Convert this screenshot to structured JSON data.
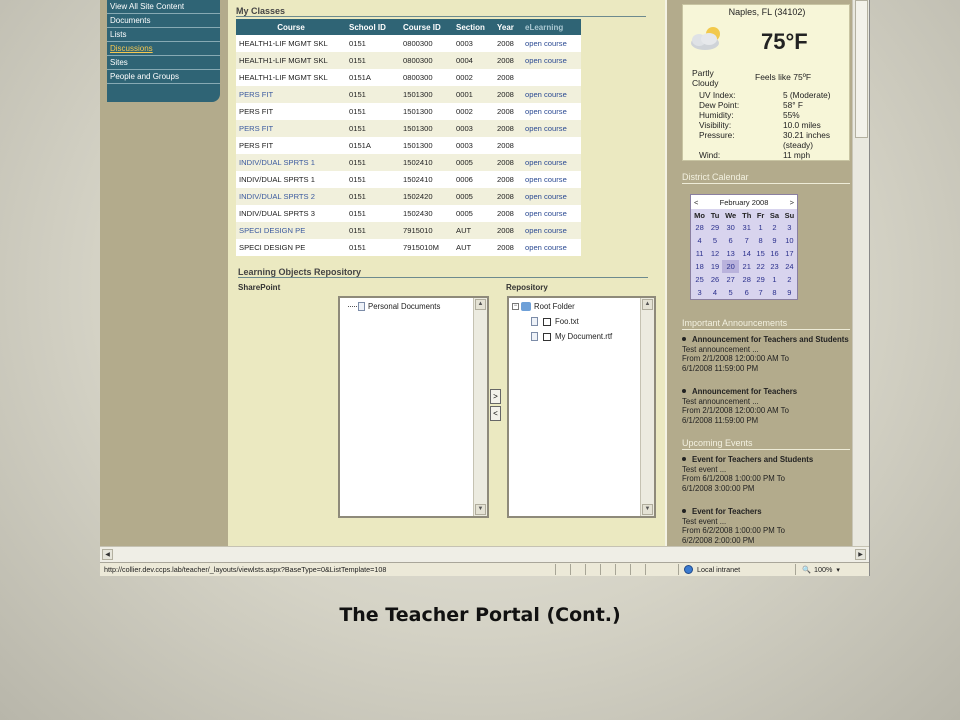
{
  "leftnav": {
    "items": [
      {
        "label": "View All Site Content",
        "active": false
      },
      {
        "label": "Documents",
        "active": false
      },
      {
        "label": "Lists",
        "active": false
      },
      {
        "label": "Discussions",
        "active": true
      },
      {
        "label": "Sites",
        "active": false
      },
      {
        "label": "People and Groups",
        "active": false
      }
    ]
  },
  "my_classes": {
    "title": "My Classes",
    "columns": [
      "Course",
      "School ID",
      "Course ID",
      "Section",
      "Year",
      "eLearning"
    ],
    "rows": [
      {
        "course": "HEALTH1-LIF MGMT SKL",
        "school": "0151",
        "course_id": "0800300",
        "section": "0003",
        "year": "2008",
        "elearning": "open course",
        "link": false
      },
      {
        "course": "HEALTH1-LIF MGMT SKL",
        "school": "0151",
        "course_id": "0800300",
        "section": "0004",
        "year": "2008",
        "elearning": "open course",
        "link": false
      },
      {
        "course": "HEALTH1-LIF MGMT SKL",
        "school": "0151A",
        "course_id": "0800300",
        "section": "0002",
        "year": "2008",
        "elearning": "",
        "link": false
      },
      {
        "course": "PERS FIT",
        "school": "0151",
        "course_id": "1501300",
        "section": "0001",
        "year": "2008",
        "elearning": "open course",
        "link": true
      },
      {
        "course": "PERS FIT",
        "school": "0151",
        "course_id": "1501300",
        "section": "0002",
        "year": "2008",
        "elearning": "open course",
        "link": false
      },
      {
        "course": "PERS FIT",
        "school": "0151",
        "course_id": "1501300",
        "section": "0003",
        "year": "2008",
        "elearning": "open course",
        "link": true
      },
      {
        "course": "PERS FIT",
        "school": "0151A",
        "course_id": "1501300",
        "section": "0003",
        "year": "2008",
        "elearning": "",
        "link": false
      },
      {
        "course": "INDIV/DUAL SPRTS 1",
        "school": "0151",
        "course_id": "1502410",
        "section": "0005",
        "year": "2008",
        "elearning": "open course",
        "link": true
      },
      {
        "course": "INDIV/DUAL SPRTS 1",
        "school": "0151",
        "course_id": "1502410",
        "section": "0006",
        "year": "2008",
        "elearning": "open course",
        "link": false
      },
      {
        "course": "INDIV/DUAL SPRTS 2",
        "school": "0151",
        "course_id": "1502420",
        "section": "0005",
        "year": "2008",
        "elearning": "open course",
        "link": true
      },
      {
        "course": "INDIV/DUAL SPRTS 3",
        "school": "0151",
        "course_id": "1502430",
        "section": "0005",
        "year": "2008",
        "elearning": "open course",
        "link": false
      },
      {
        "course": "SPECI DESIGN PE",
        "school": "0151",
        "course_id": "7915010",
        "section": "AUT",
        "year": "2008",
        "elearning": "open course",
        "link": true
      },
      {
        "course": "SPECI DESIGN PE",
        "school": "0151",
        "course_id": "7915010M",
        "section": "AUT",
        "year": "2008",
        "elearning": "open course",
        "link": false
      }
    ]
  },
  "repository": {
    "title": "Learning Objects Repository",
    "sharepoint_label": "SharePoint",
    "repository_label": "Repository",
    "sharepoint_items": [
      "Personal Documents"
    ],
    "root_folder": "Root Folder",
    "repository_items": [
      "Foo.txt",
      "My Document.rtf"
    ],
    "move_right": ">",
    "move_left": "<"
  },
  "weather": {
    "location": "Naples, FL (34102)",
    "temperature": "75°F",
    "condition": "Partly Cloudy",
    "feels_like": "Feels like 75ºF",
    "icon": "partly-cloudy-icon",
    "rows": [
      {
        "key": "UV Index:",
        "value": "5 (Moderate)"
      },
      {
        "key": "Dew Point:",
        "value": "58° F"
      },
      {
        "key": "Humidity:",
        "value": "55%"
      },
      {
        "key": "Visibility:",
        "value": "10.0 miles"
      },
      {
        "key": "Pressure:",
        "value": "30.21 inches"
      },
      {
        "key": "",
        "value": "(steady)"
      },
      {
        "key": "Wind:",
        "value": "11 mph"
      }
    ]
  },
  "district_calendar": {
    "title": "District Calendar",
    "month": "February 2008",
    "prev": "<",
    "next": ">",
    "weekdays": [
      "Mo",
      "Tu",
      "We",
      "Th",
      "Fr",
      "Sa",
      "Su"
    ],
    "weeks": [
      [
        "28",
        "29",
        "30",
        "31",
        "1",
        "2",
        "3"
      ],
      [
        "4",
        "5",
        "6",
        "7",
        "8",
        "9",
        "10"
      ],
      [
        "11",
        "12",
        "13",
        "14",
        "15",
        "16",
        "17"
      ],
      [
        "18",
        "19",
        "20",
        "21",
        "22",
        "23",
        "24"
      ],
      [
        "25",
        "26",
        "27",
        "28",
        "29",
        "1",
        "2"
      ],
      [
        "3",
        "4",
        "5",
        "6",
        "7",
        "8",
        "9"
      ]
    ],
    "today": "20"
  },
  "announcements": {
    "title": "Important Announcements",
    "items": [
      {
        "title": "Announcement for Teachers and Students",
        "body": "Test announcement ...",
        "from": "From 2/1/2008 12:00:00 AM To",
        "to": "6/1/2008 11:59:00 PM"
      },
      {
        "title": "Announcement for Teachers",
        "body": "Test announcement ...",
        "from": "From 2/1/2008 12:00:00 AM To",
        "to": "6/1/2008 11:59:00 PM"
      }
    ]
  },
  "events": {
    "title": "Upcoming Events",
    "items": [
      {
        "title": "Event for Teachers and Students",
        "body": "Test event ...",
        "from": "From 6/1/2008 1:00:00 PM To",
        "to": "6/1/2008 3:00:00 PM"
      },
      {
        "title": "Event for Teachers",
        "body": "Test event ...",
        "from": "From 6/2/2008 1:00:00 PM To",
        "to": "6/2/2008 2:00:00 PM"
      }
    ]
  },
  "statusbar": {
    "url": "http://collier.dev.ccps.lab/teacher/_layouts/viewlsts.aspx?BaseType=0&ListTemplate=108",
    "zone": "Local intranet",
    "zoom": "100%"
  },
  "caption": "The Teacher Portal (Cont.)"
}
